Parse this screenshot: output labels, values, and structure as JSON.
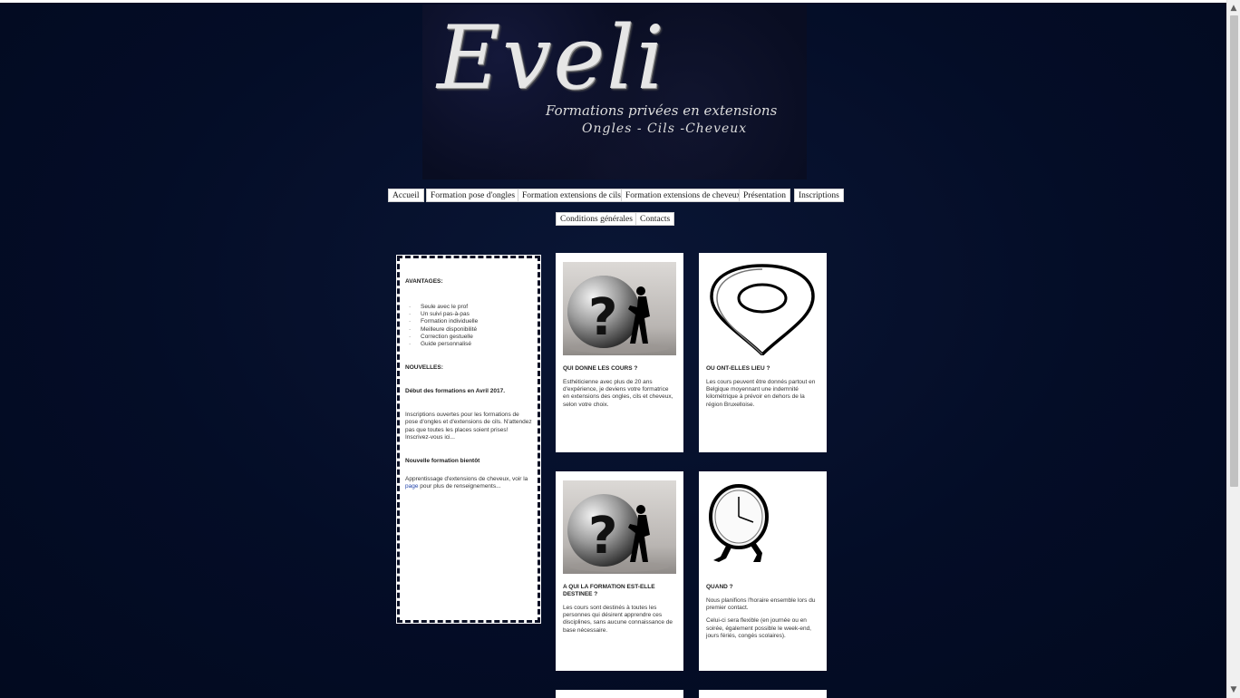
{
  "header": {
    "logo_main": "Eveli",
    "logo_sub1": "Formations privées en extensions",
    "logo_sub2": "Ongles - Cils -Cheveux"
  },
  "nav": {
    "items": [
      "Accueil",
      "Formation pose d'ongles",
      "Formation extensions de cils",
      "Formation extensions de cheveux",
      "Présentation",
      "Inscriptions",
      "Conditions générales",
      "Contacts"
    ]
  },
  "sidebar": {
    "advantages_heading": "AVANTAGES:",
    "advantages": [
      "Seule avec le prof",
      "Un suivi pas-à-pas",
      "Formation individuelle",
      "Meilleure disponibilité",
      "Correction gestuelle",
      "Guide personnalisé"
    ],
    "news_heading": "NOUVELLES:",
    "news_start": "Début des formations en Avril 2017.",
    "news_inscriptions": "Inscriptions ouvertes pour les formations de pose d'ongles et d'extensions de cils. N'attendez pas que toutes les places soient prises! Inscrivez-vous ici...",
    "new_training_heading": "Nouvelle formation bientôt",
    "new_training_text_before": "Apprentissage d'extensions de cheveux, voir la ",
    "new_training_link": "page",
    "new_training_text_after": " pour plus de renseignements..."
  },
  "cards": [
    {
      "icon": "question-sphere-icon",
      "title": "QUI DONNE LES COURS ?",
      "paragraphs": [
        "Esthéticienne avec plus de 20 ans d'expérience, je deviens votre formatrice en extensions des ongles, cils et cheveux, selon votre choix."
      ]
    },
    {
      "icon": "location-pin-icon",
      "title": "OU ONT-ELLES LIEU ?",
      "paragraphs": [
        "Les cours peuvent être donnés partout en Belgique moyennant une indemnité kilométrique à prévoir en dehors de la région Bruxelloise."
      ]
    },
    {
      "icon": "question-sphere-icon",
      "title": "A QUI LA FORMATION EST-ELLE DESTINEE ?",
      "paragraphs": [
        "Les cours sont destinés à toutes les personnes qui désirent apprendre ces disciplines, sans aucune connaissance de base nécessaire."
      ]
    },
    {
      "icon": "running-clock-icon",
      "title": "QUAND ?",
      "paragraphs": [
        "Nous planifions l'horaire ensemble lors du premier contact.",
        "Celui-ci sera flexible (en journée ou en soirée, également possible le week-end, jours fériés, congés scolaires)."
      ]
    }
  ]
}
